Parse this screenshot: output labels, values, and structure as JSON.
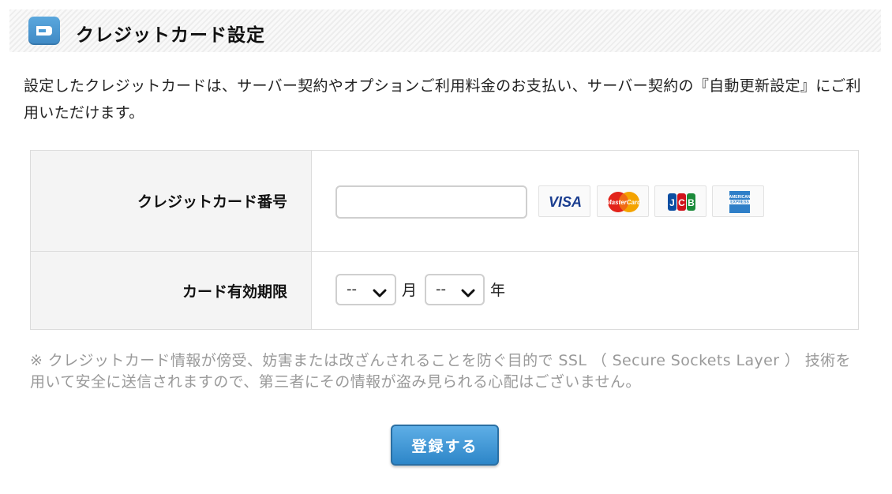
{
  "header": {
    "title": "クレジットカード設定",
    "icon": "credit-card-icon",
    "icon_color": "#4a9bd6"
  },
  "description": "設定したクレジットカードは、サーバー契約やオプションご利用料金のお支払い、サーバー契約の『自動更新設定』にご利用いただけます。",
  "form": {
    "card_number": {
      "label": "クレジットカード番号",
      "value": "",
      "brands": [
        {
          "name": "VISA",
          "icon": "visa-logo"
        },
        {
          "name": "MasterCard",
          "icon": "mastercard-logo"
        },
        {
          "name": "JCB",
          "icon": "jcb-logo"
        },
        {
          "name": "AMERICAN EXPRESS",
          "icon": "amex-logo"
        }
      ]
    },
    "expiry": {
      "label": "カード有効期限",
      "month_value": "--",
      "month_unit": "月",
      "year_value": "--",
      "year_unit": "年"
    }
  },
  "note": "※ クレジットカード情報が傍受、妨害または改ざんされることを防ぐ目的で SSL （ Secure Sockets Layer ） 技術を用いて安全に送信されますので、第三者にその情報が盗み見られる心配はございません。",
  "submit": {
    "label": "登録する",
    "color": "#3a93d4"
  }
}
